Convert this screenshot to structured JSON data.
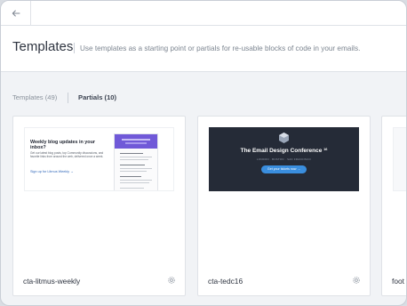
{
  "header": {
    "title": "Templates",
    "description": "Use templates as a starting point or partials for re-usable blocks of code in your emails."
  },
  "tabs": [
    {
      "label": "Templates (49)",
      "active": false
    },
    {
      "label": "Partials (10)",
      "active": true
    }
  ],
  "cards": [
    {
      "name": "cta-litmus-weekly",
      "thumbnail": {
        "heading": "Weekly blog updates in your inbox?",
        "body": "Get our latest blog posts, top Community discussions, and favorite links from around the web, delivered once a week.",
        "link": "Sign up for Litmus Weekly →"
      }
    },
    {
      "name": "cta-tedc16",
      "thumbnail": {
        "title": "The Email Design Conference",
        "title_sup": "16",
        "subtitle": "LONDON · BOSTON · SAN FRANCISCO",
        "button": "Get your tickets now →"
      }
    },
    {
      "name": "foot"
    }
  ],
  "icons": {
    "back": "arrow-left-icon",
    "settings": "gear-icon"
  },
  "colors": {
    "accent": "#3a8ede",
    "litmus_purple": "#7059d8",
    "tedc_bg": "#252b37"
  }
}
